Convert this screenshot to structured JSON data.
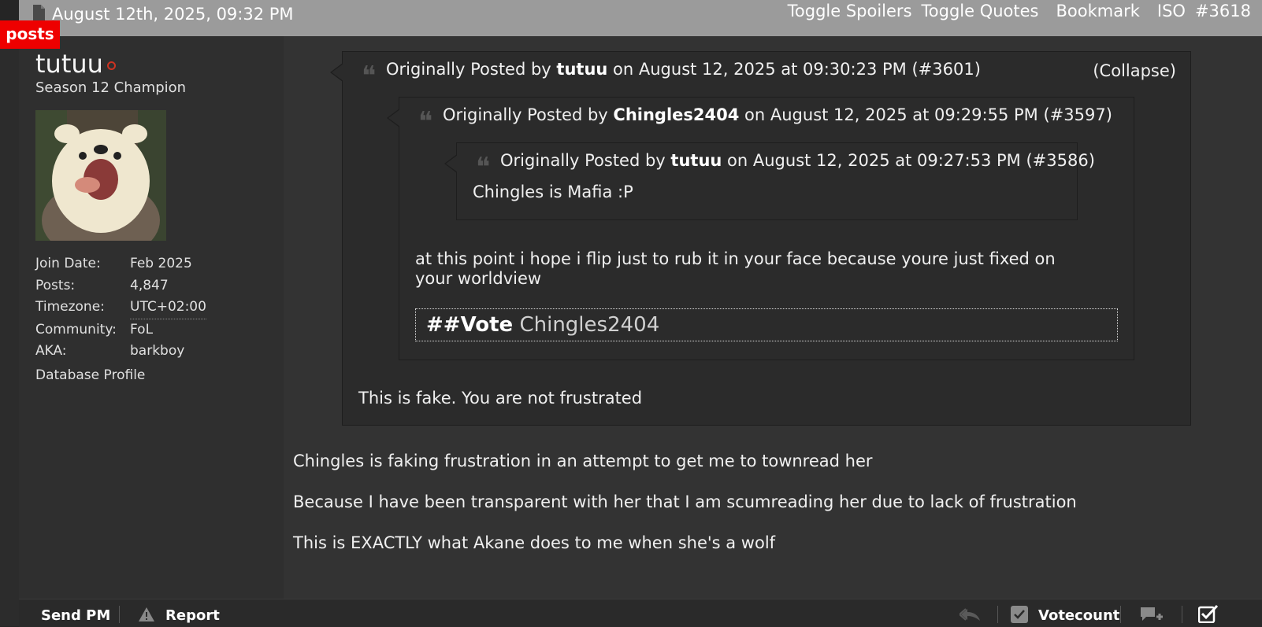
{
  "header": {
    "datetime": "August 12th, 2025, 09:32 PM",
    "toggle_spoilers": "Toggle Spoilers",
    "toggle_quotes": "Toggle Quotes",
    "bookmark": "Bookmark",
    "iso": "ISO",
    "post_number": "#3618"
  },
  "badge": "posts",
  "user": {
    "name": "tutuu",
    "title": "Season 12 Champion",
    "info": [
      {
        "label": "Join Date:",
        "value": "Feb 2025"
      },
      {
        "label": "Posts:",
        "value": "4,847"
      },
      {
        "label": "Timezone:",
        "value": "UTC+02:00"
      },
      {
        "label": "Community:",
        "value": "FoL"
      },
      {
        "label": "AKA:",
        "value": "barkboy"
      }
    ],
    "database_profile": "Database Profile"
  },
  "quote1": {
    "prefix": "Originally Posted by",
    "author": "tutuu",
    "meta": "on August 12, 2025 at 09:30:23 PM (#3601)",
    "collapse": "(Collapse)",
    "text": "This is fake. You are not frustrated"
  },
  "quote2": {
    "prefix": "Originally Posted by",
    "author": "Chingles2404",
    "meta": "on August 12, 2025 at 09:29:55 PM (#3597)",
    "text": "at this point i hope i flip just to rub it in your face because youre just fixed on your worldview",
    "vote_label": "##Vote",
    "vote_target": "Chingles2404"
  },
  "quote3": {
    "prefix": "Originally Posted by",
    "author": "tutuu",
    "meta": "on August 12, 2025 at 09:27:53 PM (#3586)",
    "text": "Chingles is Mafia :P"
  },
  "body": [
    "Chingles is faking frustration in an attempt to get me to townread her",
    "Because I have been transparent with her that I am scumreading her due to lack of frustration",
    "This is EXACTLY what Akane does to me when she's a wolf"
  ],
  "footer": {
    "send_pm": "Send PM",
    "report": "Report",
    "votecount": "Votecount"
  }
}
